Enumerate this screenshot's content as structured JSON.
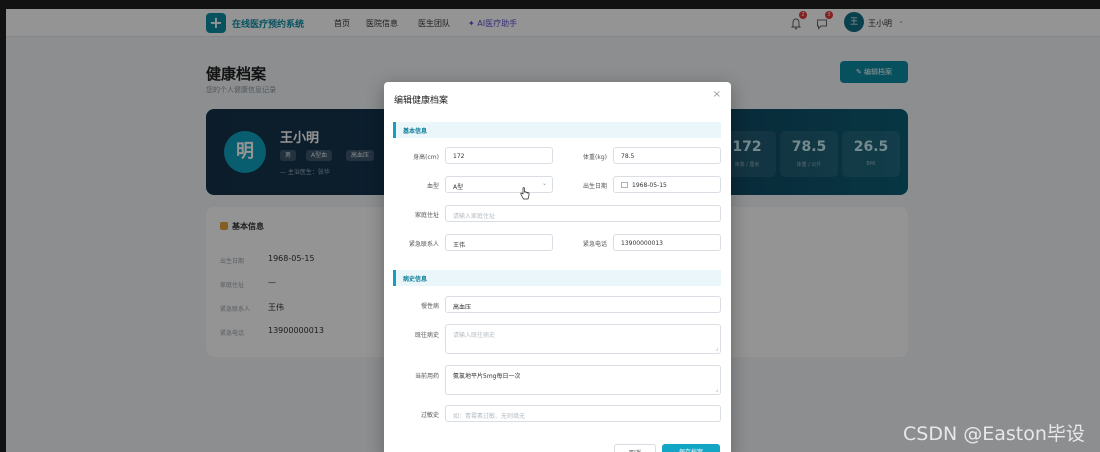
{
  "header": {
    "app_name": "在线医疗预约系统",
    "nav": [
      "首页",
      "医院信息",
      "医生团队",
      "AI医疗助手"
    ],
    "bell_badge": "2",
    "chat_badge": "3",
    "avatar_initial": "王",
    "user_name": "王小明",
    "chevron": "⌄"
  },
  "page": {
    "title": "健康档案",
    "subtitle": "您的个人健康信息记录",
    "edit_button": "✎ 编辑档案"
  },
  "profile": {
    "avatar_char": "明",
    "name": "王小明",
    "tags": [
      "男",
      "A型血",
      "高血压"
    ],
    "meta": "— 主治医生：张华",
    "stats": [
      {
        "value": "172",
        "label": "身高 / 厘米"
      },
      {
        "value": "78.5",
        "label": "体重 / 公斤"
      },
      {
        "value": "26.5",
        "label": "BMI"
      }
    ]
  },
  "info": {
    "title": "基本信息",
    "rows": [
      {
        "key": "出生日期",
        "value": "1968-05-15"
      },
      {
        "key": "家庭住址",
        "value": "—"
      },
      {
        "key": "紧急联系人",
        "value": "王伟"
      },
      {
        "key": "紧急电话",
        "value": "13900000013"
      }
    ]
  },
  "dialog": {
    "title": "编辑健康档案",
    "close": "×",
    "section_basic": "基本信息",
    "height_label": "身高(cm)",
    "height_value": "172",
    "weight_label": "体重(kg)",
    "weight_value": "78.5",
    "blood_label": "血型",
    "blood_value": "A型",
    "birth_label": "出生日期",
    "birth_value": "1968-05-15",
    "address_label": "家庭住址",
    "address_placeholder": "请输入家庭住址",
    "contact_label": "紧急联系人",
    "contact_value": "王伟",
    "phone_label": "紧急电话",
    "phone_value": "13900000013",
    "section_medical": "病史信息",
    "chronic_label": "慢性病",
    "chronic_value": "高血压",
    "past_label": "既往病史",
    "past_placeholder": "请输入既往病史",
    "medication_label": "当前用药",
    "medication_value": "氨氯地平片5mg每日一次",
    "allergy_label": "过敏史",
    "allergy_placeholder": "如：青霉素过敏、无则填无",
    "cancel_label": "取消",
    "save_label": "保存档案"
  },
  "watermark": "CSDN @Easton毕设"
}
